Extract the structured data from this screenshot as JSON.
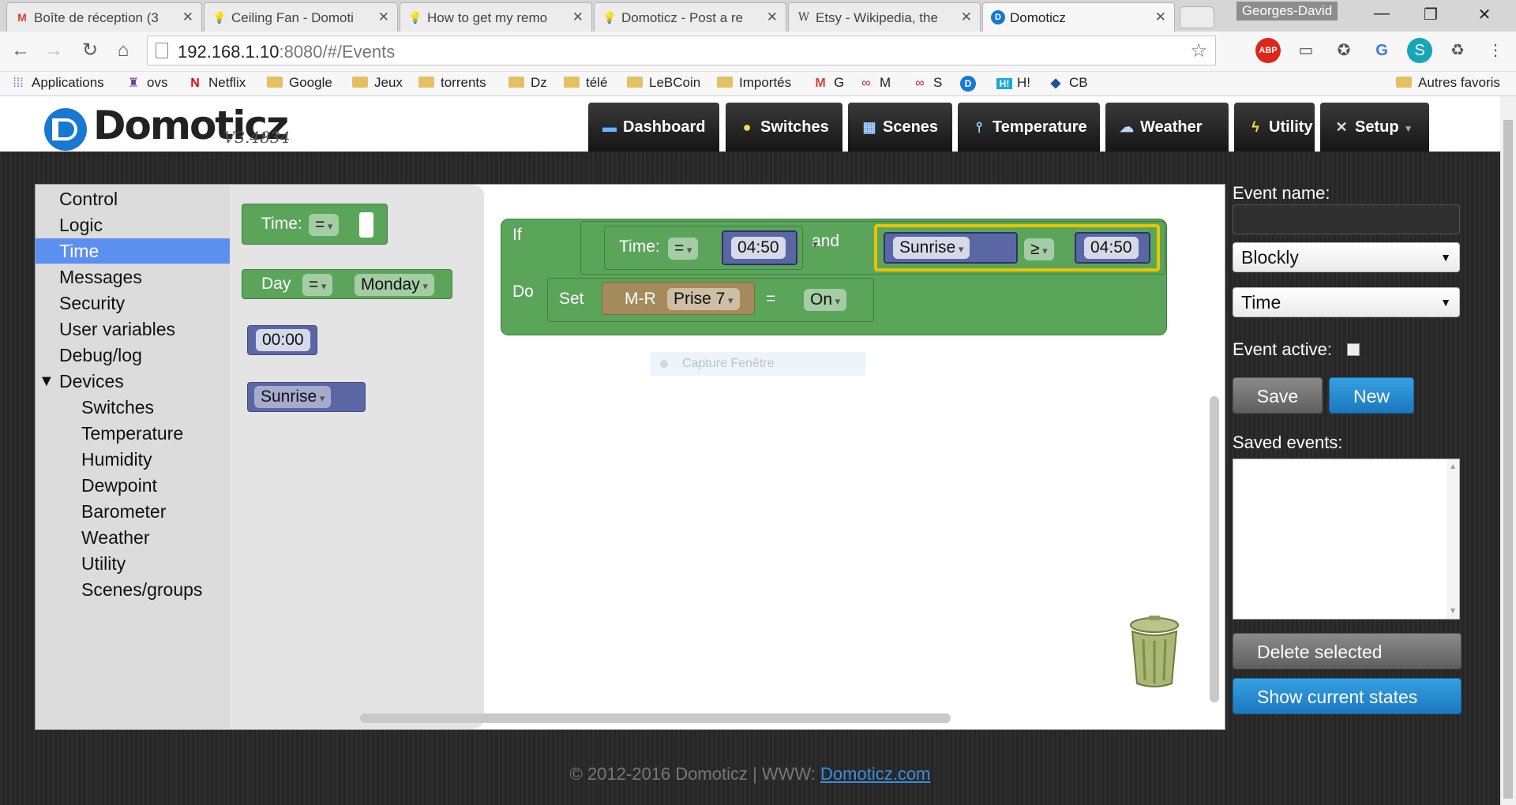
{
  "browser": {
    "tabs": [
      {
        "title": "Boîte de réception (3",
        "favicon": "M"
      },
      {
        "title": "Ceiling Fan - Domoti",
        "favicon": "💡"
      },
      {
        "title": "How to get my remo",
        "favicon": "💡"
      },
      {
        "title": "Domoticz - Post a re",
        "favicon": "💡"
      },
      {
        "title": "Etsy - Wikipedia, the",
        "favicon": "W"
      },
      {
        "title": "Domoticz",
        "favicon": "D"
      }
    ],
    "profile_name": "Georges-David",
    "url_host": "192.168.1.10",
    "url_rest": ":8080/#/Events",
    "bookmarks": [
      {
        "label": "Applications",
        "icon": "apps-grid-icon"
      },
      {
        "label": "ovs",
        "icon": "ovs-icon"
      },
      {
        "label": "Netflix",
        "icon": "netflix-icon"
      },
      {
        "label": "Google",
        "icon": "folder-icon"
      },
      {
        "label": "Jeux",
        "icon": "folder-icon"
      },
      {
        "label": "torrents",
        "icon": "folder-icon"
      },
      {
        "label": "Dz",
        "icon": "folder-icon"
      },
      {
        "label": "télé",
        "icon": "folder-icon"
      },
      {
        "label": "LeBCoin",
        "icon": "folder-icon"
      },
      {
        "label": "Importés",
        "icon": "folder-icon"
      },
      {
        "label": "G",
        "icon": "gmail-icon"
      },
      {
        "label": "M",
        "icon": "link-icon"
      },
      {
        "label": "S",
        "icon": "link-icon"
      },
      {
        "label": "",
        "icon": "domoticz-icon"
      },
      {
        "label": "H!",
        "icon": "h-icon"
      },
      {
        "label": "CB",
        "icon": "carrefour-icon"
      }
    ],
    "other_bookmarks": "Autres favoris"
  },
  "app": {
    "logo_text": "Domoticz",
    "version": "V3.4834",
    "nav": [
      {
        "label": "Dashboard",
        "icon": "monitor-icon"
      },
      {
        "label": "Switches",
        "icon": "bulb-icon"
      },
      {
        "label": "Scenes",
        "icon": "clapper-icon"
      },
      {
        "label": "Temperature",
        "icon": "thermometer-icon"
      },
      {
        "label": "Weather",
        "icon": "cloud-icon"
      },
      {
        "label": "Utility",
        "icon": "lightning-icon"
      },
      {
        "label": "Setup",
        "icon": "tools-icon"
      }
    ]
  },
  "categories": {
    "control": "Control",
    "logic": "Logic",
    "time": "Time",
    "messages": "Messages",
    "security": "Security",
    "user_variables": "User variables",
    "debug_log": "Debug/log",
    "devices": "Devices",
    "devices_children": [
      "Switches",
      "Temperature",
      "Humidity",
      "Dewpoint",
      "Barometer",
      "Weather",
      "Utility",
      "Scenes/groups"
    ]
  },
  "flyout": {
    "time_label": "Time:",
    "time_op": "=",
    "day_label": "Day",
    "day_op": "=",
    "day_value": "Monday",
    "time_value": "00:00",
    "sun_value": "Sunrise"
  },
  "workspace": {
    "if_label": "If",
    "do_label": "Do",
    "time_label": "Time:",
    "time_op": "=",
    "time_value": "04:50",
    "and_label": "and",
    "sunrise": "Sunrise",
    "cmp_op": "≥",
    "cmp_value": "04:50",
    "set_label": "Set",
    "device_prefix": "M-R",
    "device_name": "Prise 7",
    "eq": "=",
    "state": "On"
  },
  "overlay": {
    "capture_hint": "Capture Fenêtre"
  },
  "panel": {
    "event_name_label": "Event name:",
    "event_name_value": "",
    "type_select": "Blockly",
    "trigger_select": "Time",
    "event_active_label": "Event active:",
    "save": "Save",
    "new": "New",
    "saved_events_label": "Saved events:",
    "delete_selected": "Delete selected",
    "show_current_states": "Show current states"
  },
  "footer": {
    "copyright": "© 2012-2016 Domoticz | WWW: ",
    "link": "Domoticz.com"
  }
}
